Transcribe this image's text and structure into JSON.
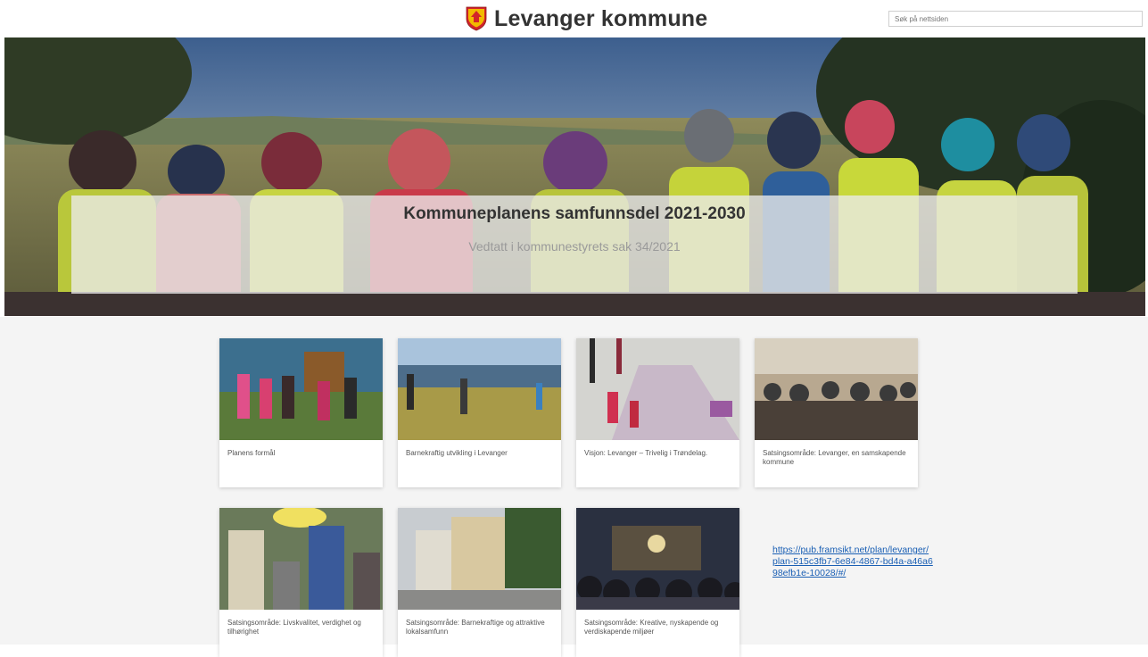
{
  "header": {
    "site_title": "Levanger kommune",
    "search_placeholder": "Søk på nettsiden"
  },
  "hero": {
    "title": "Kommuneplanens samfunnsdel 2021-2030",
    "subtitle": "Vedtatt i kommunestyrets sak 34/2021"
  },
  "cards": [
    {
      "label": "Planens formål"
    },
    {
      "label": "Barnekraftig utvikling i Levanger"
    },
    {
      "label": "Visjon: Levanger – Trivelig i Trøndelag."
    },
    {
      "label": "Satsingsområde: Levanger, en samskapende kommune"
    },
    {
      "label": "Satsingsområde: Livskvalitet, verdighet og tilhørighet"
    },
    {
      "label": "Satsingsområde: Barnekraftige og attraktive lokalsamfunn"
    },
    {
      "label": "Satsingsområde: Kreative, nyskapende og verdiskapende miljøer"
    }
  ],
  "link": {
    "text": "https://pub.framsikt.net/plan/levanger/plan-515c3fb7-6e84-4867-bd4a-a46a698efb1e-10028/#/"
  },
  "colors": {
    "shield_yellow": "#f2b900",
    "shield_red": "#d2232a",
    "link_blue": "#1a5fb4"
  }
}
